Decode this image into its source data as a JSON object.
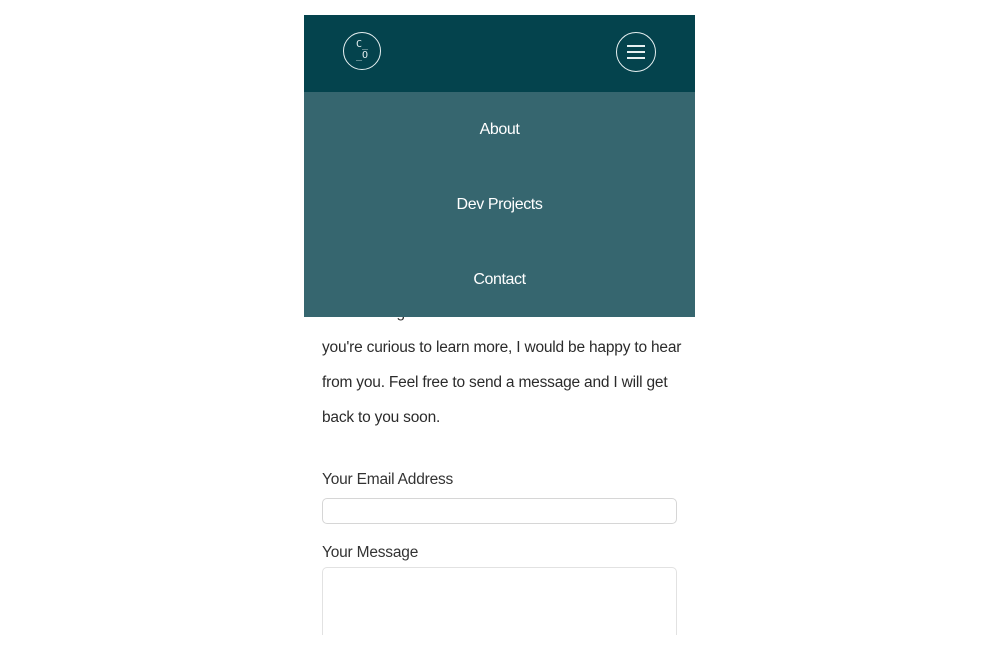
{
  "header": {
    "logo_line1": "C_",
    "logo_line2": "_O"
  },
  "nav": {
    "items": [
      {
        "label": "About"
      },
      {
        "label": "Dev Projects"
      },
      {
        "label": "Contact"
      }
    ]
  },
  "contact": {
    "intro_lines": [
      "and learning about other cultures around. If",
      "you're curious to learn more, I would be happy to hear",
      "from you. Feel free to send a message and I will get",
      "back to you soon."
    ],
    "email_label": "Your Email Address",
    "email_value": "",
    "message_label": "Your Message",
    "message_value": ""
  },
  "colors": {
    "header_bg": "#04434d",
    "nav_bg": "#36666f"
  }
}
